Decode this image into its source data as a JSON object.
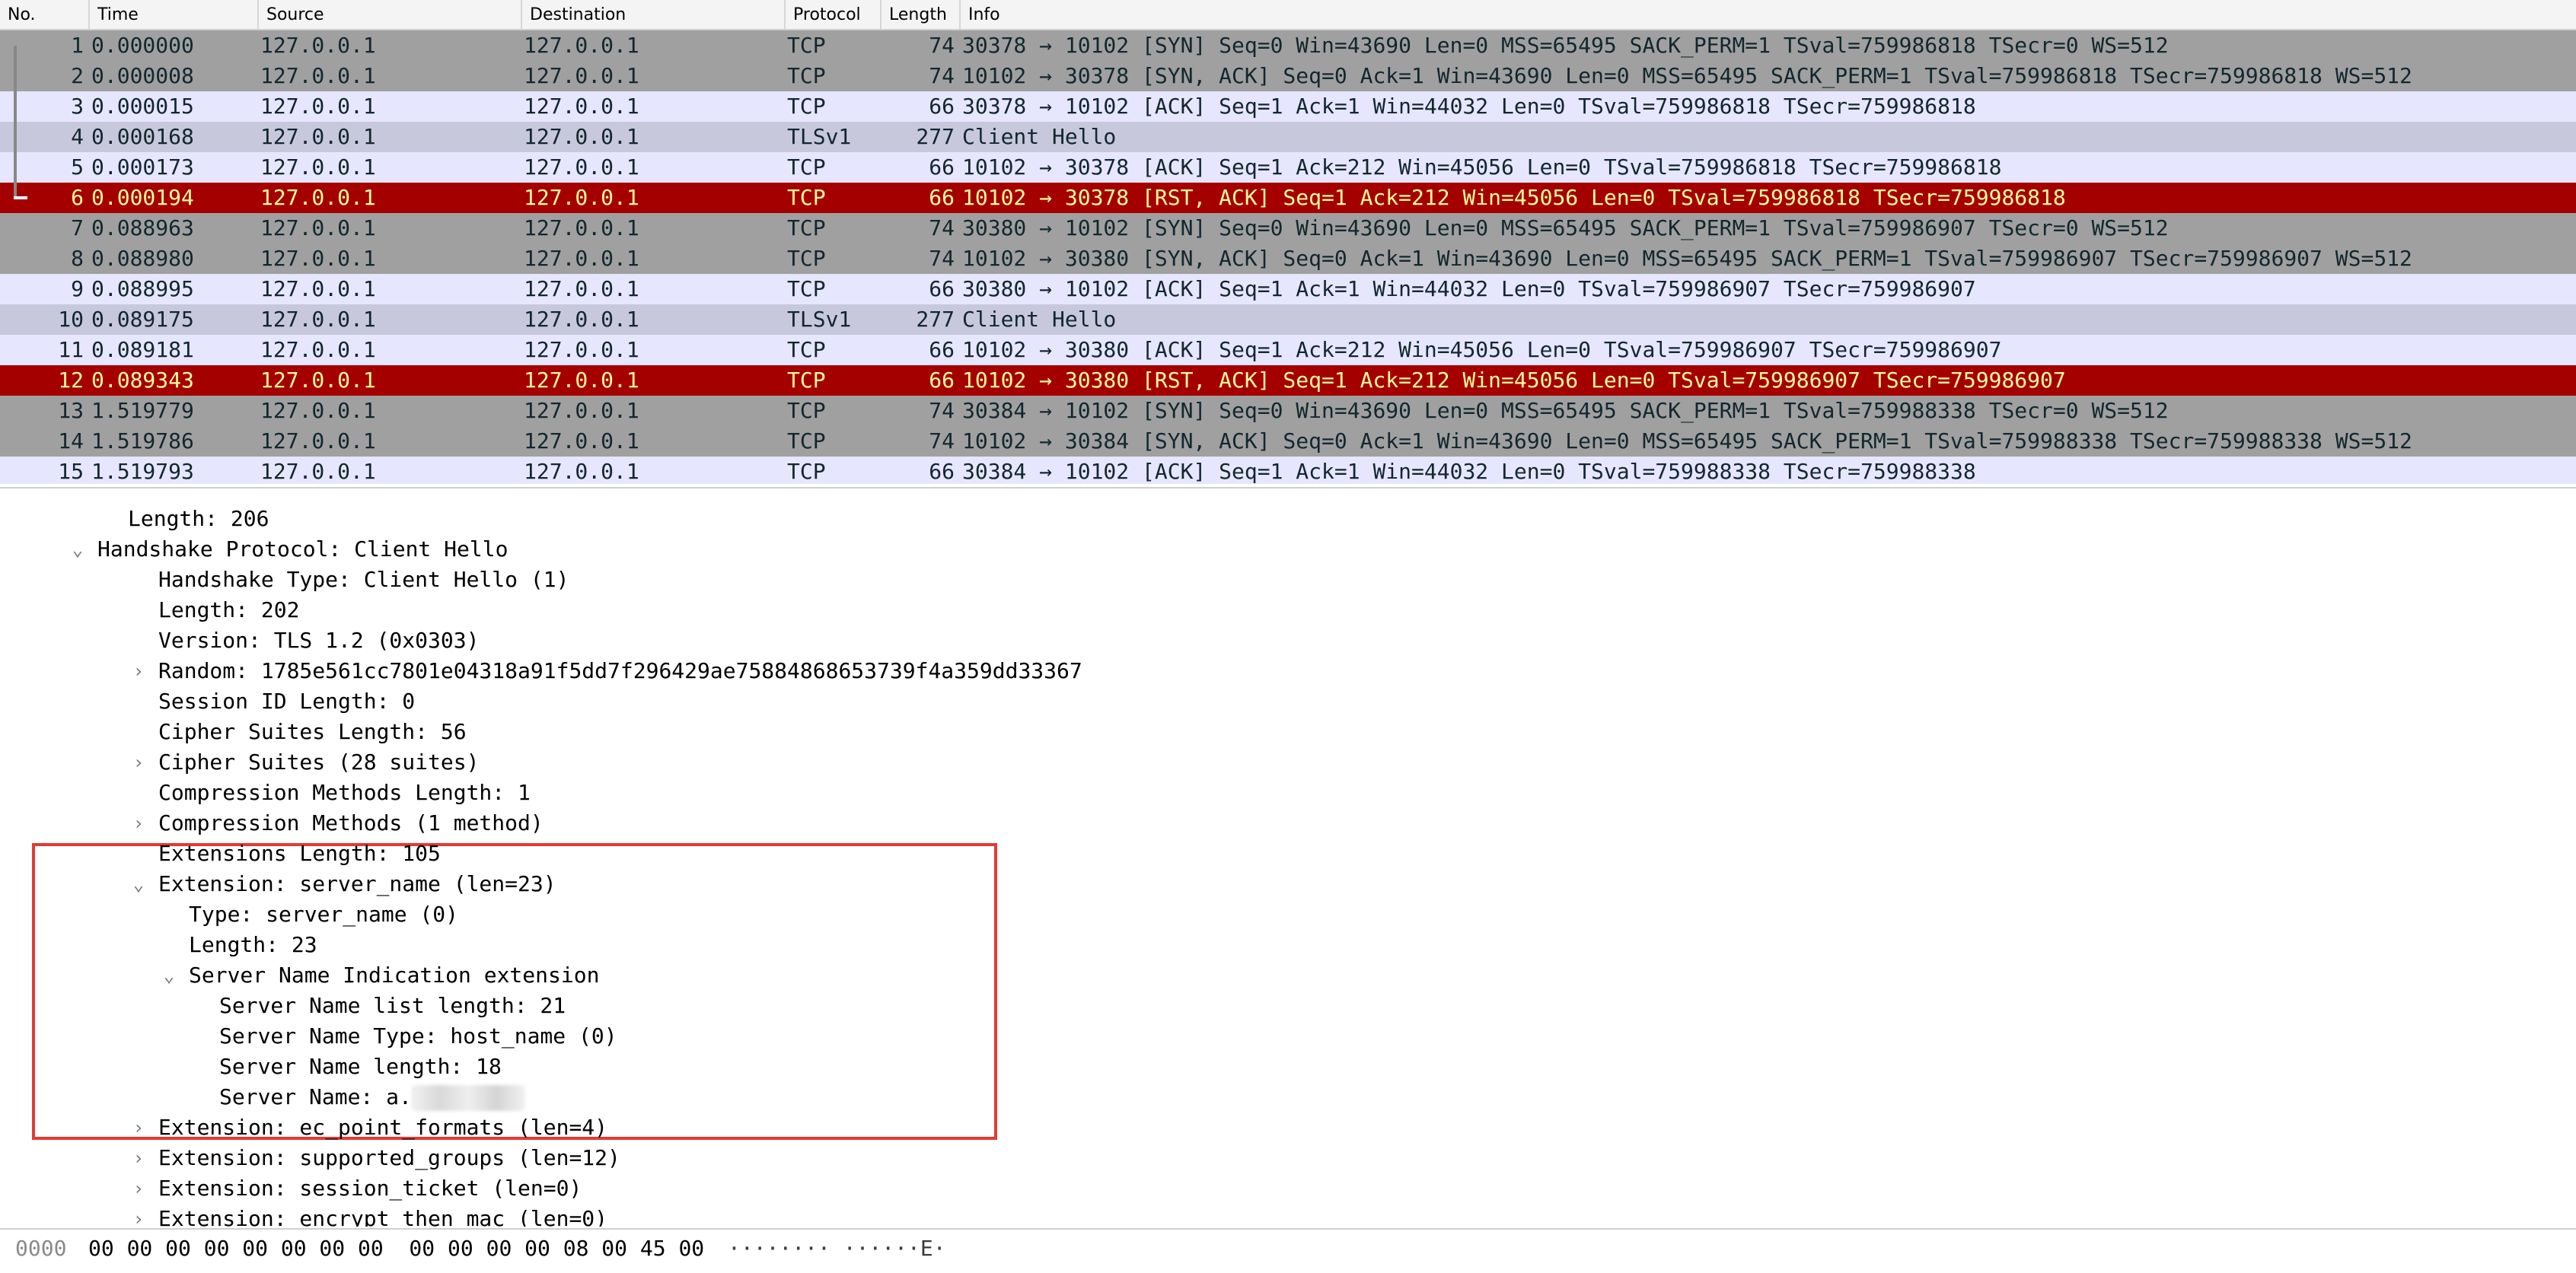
{
  "packet_list": {
    "columns": {
      "no": "No.",
      "time": "Time",
      "source": "Source",
      "destination": "Destination",
      "protocol": "Protocol",
      "length": "Length",
      "info": "Info"
    },
    "rows": [
      {
        "no": "1",
        "time": "0.000000",
        "src": "127.0.0.1",
        "dst": "127.0.0.1",
        "proto": "TCP",
        "len": "74",
        "info": "30378 → 10102 [SYN] Seq=0 Win=43690 Len=0 MSS=65495 SACK_PERM=1 TSval=759986818 TSecr=0 WS=512"
      },
      {
        "no": "2",
        "time": "0.000008",
        "src": "127.0.0.1",
        "dst": "127.0.0.1",
        "proto": "TCP",
        "len": "74",
        "info": "10102 → 30378 [SYN, ACK] Seq=0 Ack=1 Win=43690 Len=0 MSS=65495 SACK_PERM=1 TSval=759986818 TSecr=759986818 WS=512"
      },
      {
        "no": "3",
        "time": "0.000015",
        "src": "127.0.0.1",
        "dst": "127.0.0.1",
        "proto": "TCP",
        "len": "66",
        "info": "30378 → 10102 [ACK] Seq=1 Ack=1 Win=44032 Len=0 TSval=759986818 TSecr=759986818"
      },
      {
        "no": "4",
        "time": "0.000168",
        "src": "127.0.0.1",
        "dst": "127.0.0.1",
        "proto": "TLSv1",
        "len": "277",
        "info": "Client Hello"
      },
      {
        "no": "5",
        "time": "0.000173",
        "src": "127.0.0.1",
        "dst": "127.0.0.1",
        "proto": "TCP",
        "len": "66",
        "info": "10102 → 30378 [ACK] Seq=1 Ack=212 Win=45056 Len=0 TSval=759986818 TSecr=759986818"
      },
      {
        "no": "6",
        "time": "0.000194",
        "src": "127.0.0.1",
        "dst": "127.0.0.1",
        "proto": "TCP",
        "len": "66",
        "info": "10102 → 30378 [RST, ACK] Seq=1 Ack=212 Win=45056 Len=0 TSval=759986818 TSecr=759986818"
      },
      {
        "no": "7",
        "time": "0.088963",
        "src": "127.0.0.1",
        "dst": "127.0.0.1",
        "proto": "TCP",
        "len": "74",
        "info": "30380 → 10102 [SYN] Seq=0 Win=43690 Len=0 MSS=65495 SACK_PERM=1 TSval=759986907 TSecr=0 WS=512"
      },
      {
        "no": "8",
        "time": "0.088980",
        "src": "127.0.0.1",
        "dst": "127.0.0.1",
        "proto": "TCP",
        "len": "74",
        "info": "10102 → 30380 [SYN, ACK] Seq=0 Ack=1 Win=43690 Len=0 MSS=65495 SACK_PERM=1 TSval=759986907 TSecr=759986907 WS=512"
      },
      {
        "no": "9",
        "time": "0.088995",
        "src": "127.0.0.1",
        "dst": "127.0.0.1",
        "proto": "TCP",
        "len": "66",
        "info": "30380 → 10102 [ACK] Seq=1 Ack=1 Win=44032 Len=0 TSval=759986907 TSecr=759986907"
      },
      {
        "no": "10",
        "time": "0.089175",
        "src": "127.0.0.1",
        "dst": "127.0.0.1",
        "proto": "TLSv1",
        "len": "277",
        "info": "Client Hello"
      },
      {
        "no": "11",
        "time": "0.089181",
        "src": "127.0.0.1",
        "dst": "127.0.0.1",
        "proto": "TCP",
        "len": "66",
        "info": "10102 → 30380 [ACK] Seq=1 Ack=212 Win=45056 Len=0 TSval=759986907 TSecr=759986907"
      },
      {
        "no": "12",
        "time": "0.089343",
        "src": "127.0.0.1",
        "dst": "127.0.0.1",
        "proto": "TCP",
        "len": "66",
        "info": "10102 → 30380 [RST, ACK] Seq=1 Ack=212 Win=45056 Len=0 TSval=759986907 TSecr=759986907"
      },
      {
        "no": "13",
        "time": "1.519779",
        "src": "127.0.0.1",
        "dst": "127.0.0.1",
        "proto": "TCP",
        "len": "74",
        "info": "30384 → 10102 [SYN] Seq=0 Win=43690 Len=0 MSS=65495 SACK_PERM=1 TSval=759988338 TSecr=0 WS=512"
      },
      {
        "no": "14",
        "time": "1.519786",
        "src": "127.0.0.1",
        "dst": "127.0.0.1",
        "proto": "TCP",
        "len": "74",
        "info": "10102 → 30384 [SYN, ACK] Seq=0 Ack=1 Win=43690 Len=0 MSS=65495 SACK_PERM=1 TSval=759988338 TSecr=759988338 WS=512"
      },
      {
        "no": "15",
        "time": "1.519793",
        "src": "127.0.0.1",
        "dst": "127.0.0.1",
        "proto": "TCP",
        "len": "66",
        "info": "30384 → 10102 [ACK] Seq=1 Ack=1 Win=44032 Len=0 TSval=759988338 TSecr=759988338"
      }
    ]
  },
  "colors": {
    "gray_row": "#a0a0a0",
    "lavender_row": "#e7e6ff",
    "tls_row": "#c8c8dc",
    "rst_row": "#a40000",
    "rst_text": "#fffc9c",
    "highlight_box": "#e53935"
  },
  "details": {
    "items": [
      {
        "text": "Length: 206"
      },
      {
        "text": "Handshake Protocol: Client Hello",
        "expander": "expanded"
      },
      {
        "text": "Handshake Type: Client Hello (1)"
      },
      {
        "text": "Length: 202"
      },
      {
        "text": "Version: TLS 1.2 (0x0303)"
      },
      {
        "text": "Random: 1785e561cc7801e04318a91f5dd7f296429ae75884868653739f4a359dd33367",
        "expander": "collapsed"
      },
      {
        "text": "Session ID Length: 0"
      },
      {
        "text": "Cipher Suites Length: 56"
      },
      {
        "text": "Cipher Suites (28 suites)",
        "expander": "collapsed"
      },
      {
        "text": "Compression Methods Length: 1"
      },
      {
        "text": "Compression Methods (1 method)",
        "expander": "collapsed"
      },
      {
        "text": "Extensions Length: 105"
      },
      {
        "text": "Extension: server_name (len=23)",
        "expander": "expanded"
      },
      {
        "text": "Type: server_name (0)"
      },
      {
        "text": "Length: 23"
      },
      {
        "text": "Server Name Indication extension",
        "expander": "expanded"
      },
      {
        "text": "Server Name list length: 21"
      },
      {
        "text": "Server Name Type: host_name (0)"
      },
      {
        "text": "Server Name length: 18"
      },
      {
        "text": "Server Name: a.hu        i.com"
      },
      {
        "text": "Extension: ec_point_formats (len=4)",
        "expander": "collapsed"
      },
      {
        "text": "Extension: supported_groups (len=12)",
        "expander": "collapsed"
      },
      {
        "text": "Extension: session_ticket (len=0)",
        "expander": "collapsed"
      },
      {
        "text": "Extension: encrypt_then_mac (len=0)",
        "expander": "collapsed"
      }
    ]
  },
  "bytes": {
    "offset": "0000",
    "hex": "00 00 00 00 00 00 00 00  00 00 00 00 08 00 45 00",
    "ascii": "········ ······E·"
  }
}
